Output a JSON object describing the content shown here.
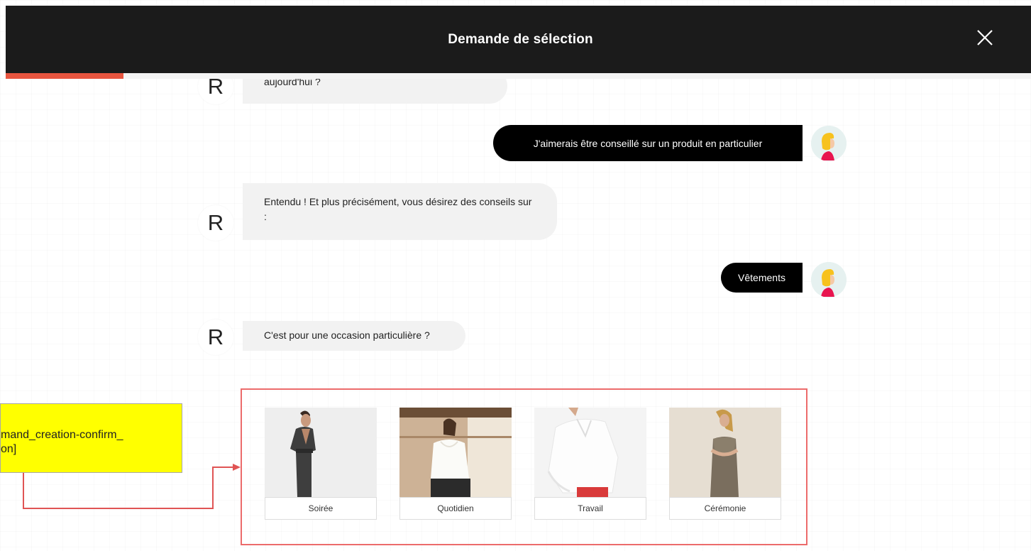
{
  "modal": {
    "title": "Demande de sélection",
    "close_icon": "close-icon"
  },
  "progress": {
    "value_percent": 11.5,
    "color": "#e8553f"
  },
  "chat": {
    "bot_avatar_letter": "R",
    "messages": [
      {
        "from": "bot",
        "text": "aujourd'hui ?"
      },
      {
        "from": "user",
        "text": "J'aimerais être conseillé sur un produit en particulier"
      },
      {
        "from": "bot",
        "text": "Entendu ! Et plus précisément, vous désirez des conseils sur :"
      },
      {
        "from": "user",
        "text": "Vêtements"
      },
      {
        "from": "bot",
        "text": "C'est pour une occasion particulière ?"
      }
    ]
  },
  "choices": [
    {
      "label": "Soirée"
    },
    {
      "label": "Quotidien"
    },
    {
      "label": "Travail"
    },
    {
      "label": "Cérémonie"
    }
  ],
  "annotation": {
    "text": "mand_creation-confirm_\non]",
    "background": "#ffff00",
    "border_color": "#ec6b6b"
  }
}
